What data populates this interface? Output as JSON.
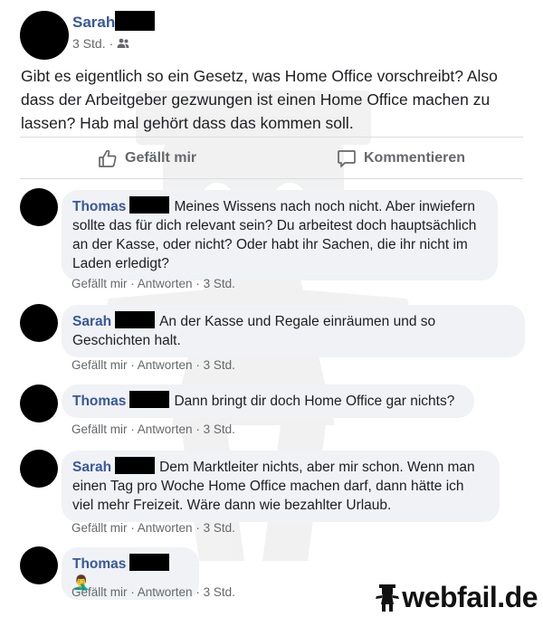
{
  "post": {
    "author": "Sarah",
    "time": "3 Std.",
    "text": "Gibt es eigentlich so ein Gesetz, was Home Office vorschreibt? Also dass der Arbeitgeber gezwungen ist einen Home Office machen zu lassen? Hab mal gehört dass das kommen soll.",
    "like_label": "Gefällt mir",
    "comment_label": "Kommentieren"
  },
  "comments": [
    {
      "author": "Thomas",
      "text": "Meines Wissens nach noch nicht. Aber inwiefern sollte das für dich relevant sein? Du arbeitest doch hauptsächlich an der Kasse, oder nicht? Oder habt ihr Sachen, die ihr nicht im Laden erledigt?",
      "like": "Gefällt mir",
      "reply": "Antworten",
      "time": "3 Std."
    },
    {
      "author": "Sarah",
      "text": "An der Kasse und Regale einräumen und so Geschichten halt.",
      "like": "Gefällt mir",
      "reply": "Antworten",
      "time": "3 Std."
    },
    {
      "author": "Thomas",
      "text": "Dann bringt dir doch Home Office gar nichts?",
      "like": "Gefällt mir",
      "reply": "Antworten",
      "time": "3 Std."
    },
    {
      "author": "Sarah",
      "text": "Dem Marktleiter nichts, aber mir schon. Wenn man einen Tag pro Woche Home Office machen darf, dann hätte ich viel mehr Freizeit. Wäre dann wie bezahlter Urlaub.",
      "like": "Gefällt mir",
      "reply": "Antworten",
      "time": "3 Std."
    },
    {
      "author": "Thomas",
      "text": "",
      "emoji": "🤦‍♂️",
      "like": "Gefällt mir",
      "reply": "Antworten",
      "time": "3 Std."
    }
  ],
  "watermark": {
    "logo_text": "webfail.de"
  },
  "icons": {
    "audience": "friends-icon",
    "like": "thumbs-up-icon",
    "comment": "speech-bubble-icon",
    "logo": "waiter-figure-icon"
  },
  "colors": {
    "name": "#385898",
    "meta": "#65676b",
    "bubble": "#f0f2f5"
  }
}
